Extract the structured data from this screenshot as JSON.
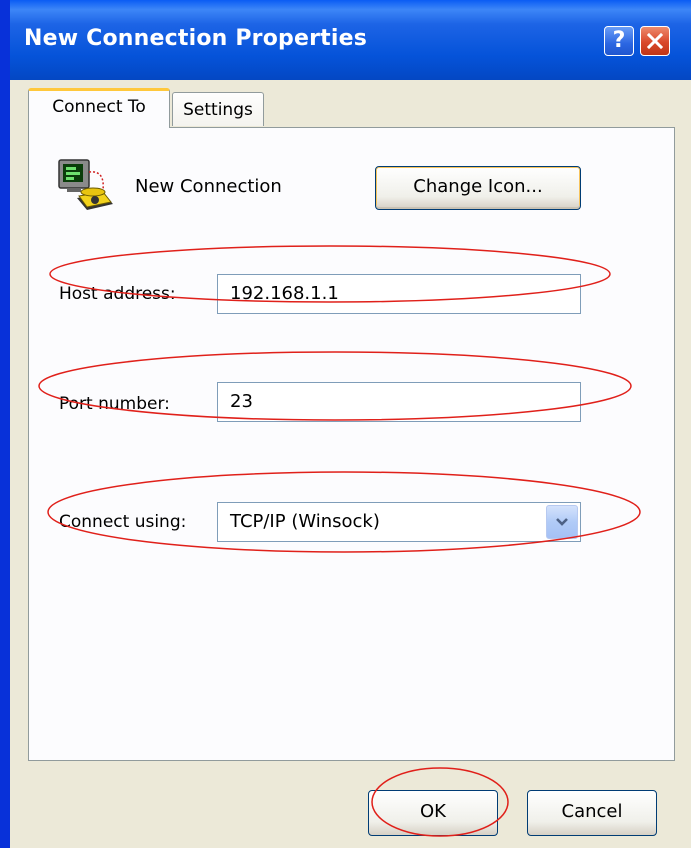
{
  "window": {
    "title": "New Connection Properties",
    "help_label": "?"
  },
  "tabs": [
    {
      "label": "Connect To",
      "active": true
    },
    {
      "label": "Settings",
      "active": false
    }
  ],
  "connect_to": {
    "connection_name": "New Connection",
    "change_icon_label": "Change Icon...",
    "host_address_label": "Host address:",
    "host_address_value": "192.168.1.1",
    "port_number_label": "Port number:",
    "port_number_value": "23",
    "connect_using_label": "Connect using:",
    "connect_using_value": "TCP/IP (Winsock)"
  },
  "footer": {
    "ok_label": "OK",
    "cancel_label": "Cancel"
  },
  "colors": {
    "titlebar": "#0553d9",
    "dialog_bg": "#ece9d8",
    "annotation": "#e0201a",
    "active_tab_accent": "#ffc83c"
  },
  "icons": [
    "hyperterminal-connection-icon",
    "help-icon",
    "close-icon",
    "chevron-down-icon"
  ]
}
